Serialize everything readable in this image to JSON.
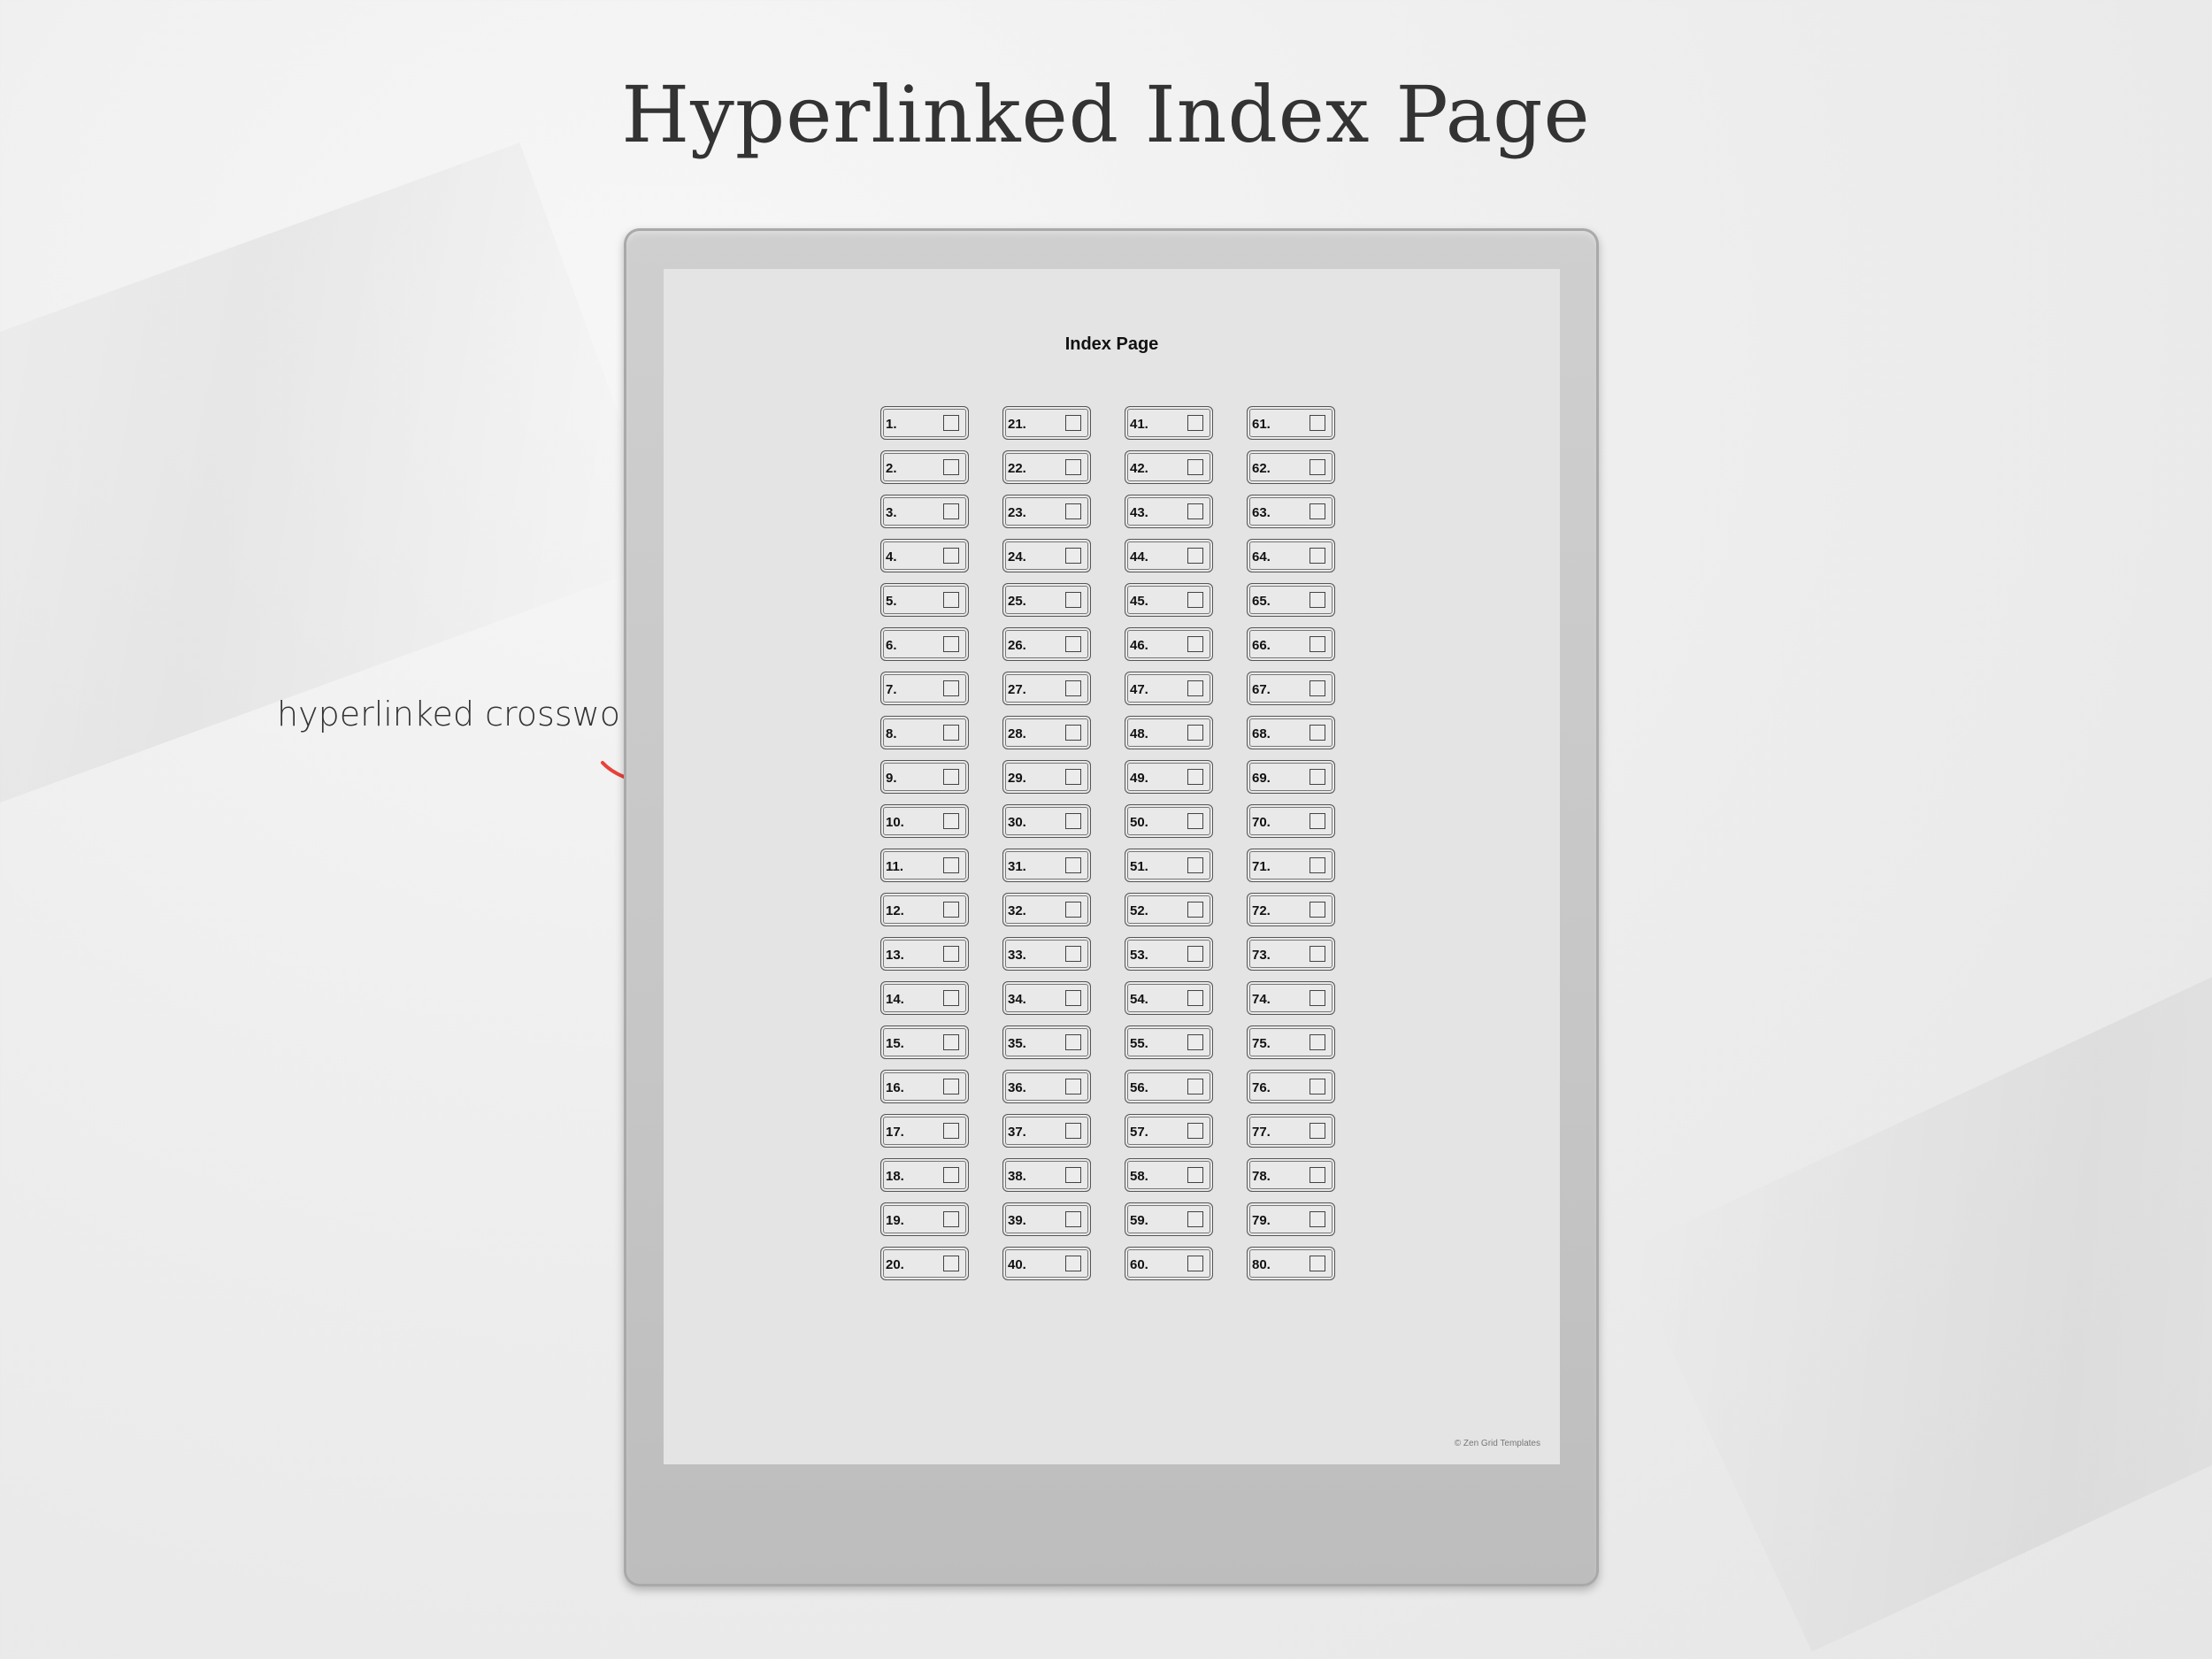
{
  "headline": "Hyperlinked Index Page",
  "annotation": {
    "label": "hyperlinked crosswords",
    "arrow_color": "#e8423a",
    "arrow_icon": "curved-arrow-right-icon"
  },
  "screen": {
    "title": "Index Page",
    "copyright": "© Zen Grid Templates",
    "columns": [
      [
        "1.",
        "2.",
        "3.",
        "4.",
        "5.",
        "6.",
        "7.",
        "8.",
        "9.",
        "10.",
        "11.",
        "12.",
        "13.",
        "14.",
        "15.",
        "16.",
        "17.",
        "18.",
        "19.",
        "20."
      ],
      [
        "21.",
        "22.",
        "23.",
        "24.",
        "25.",
        "26.",
        "27.",
        "28.",
        "29.",
        "30.",
        "31.",
        "32.",
        "33.",
        "34.",
        "35.",
        "36.",
        "37.",
        "38.",
        "39.",
        "40."
      ],
      [
        "41.",
        "42.",
        "43.",
        "44.",
        "45.",
        "46.",
        "47.",
        "48.",
        "49.",
        "50.",
        "51.",
        "52.",
        "53.",
        "54.",
        "55.",
        "56.",
        "57.",
        "58.",
        "59.",
        "60."
      ],
      [
        "61.",
        "62.",
        "63.",
        "64.",
        "65.",
        "66.",
        "67.",
        "68.",
        "69.",
        "70.",
        "71.",
        "72.",
        "73.",
        "74.",
        "75.",
        "76.",
        "77.",
        "78.",
        "79.",
        "80."
      ]
    ]
  }
}
